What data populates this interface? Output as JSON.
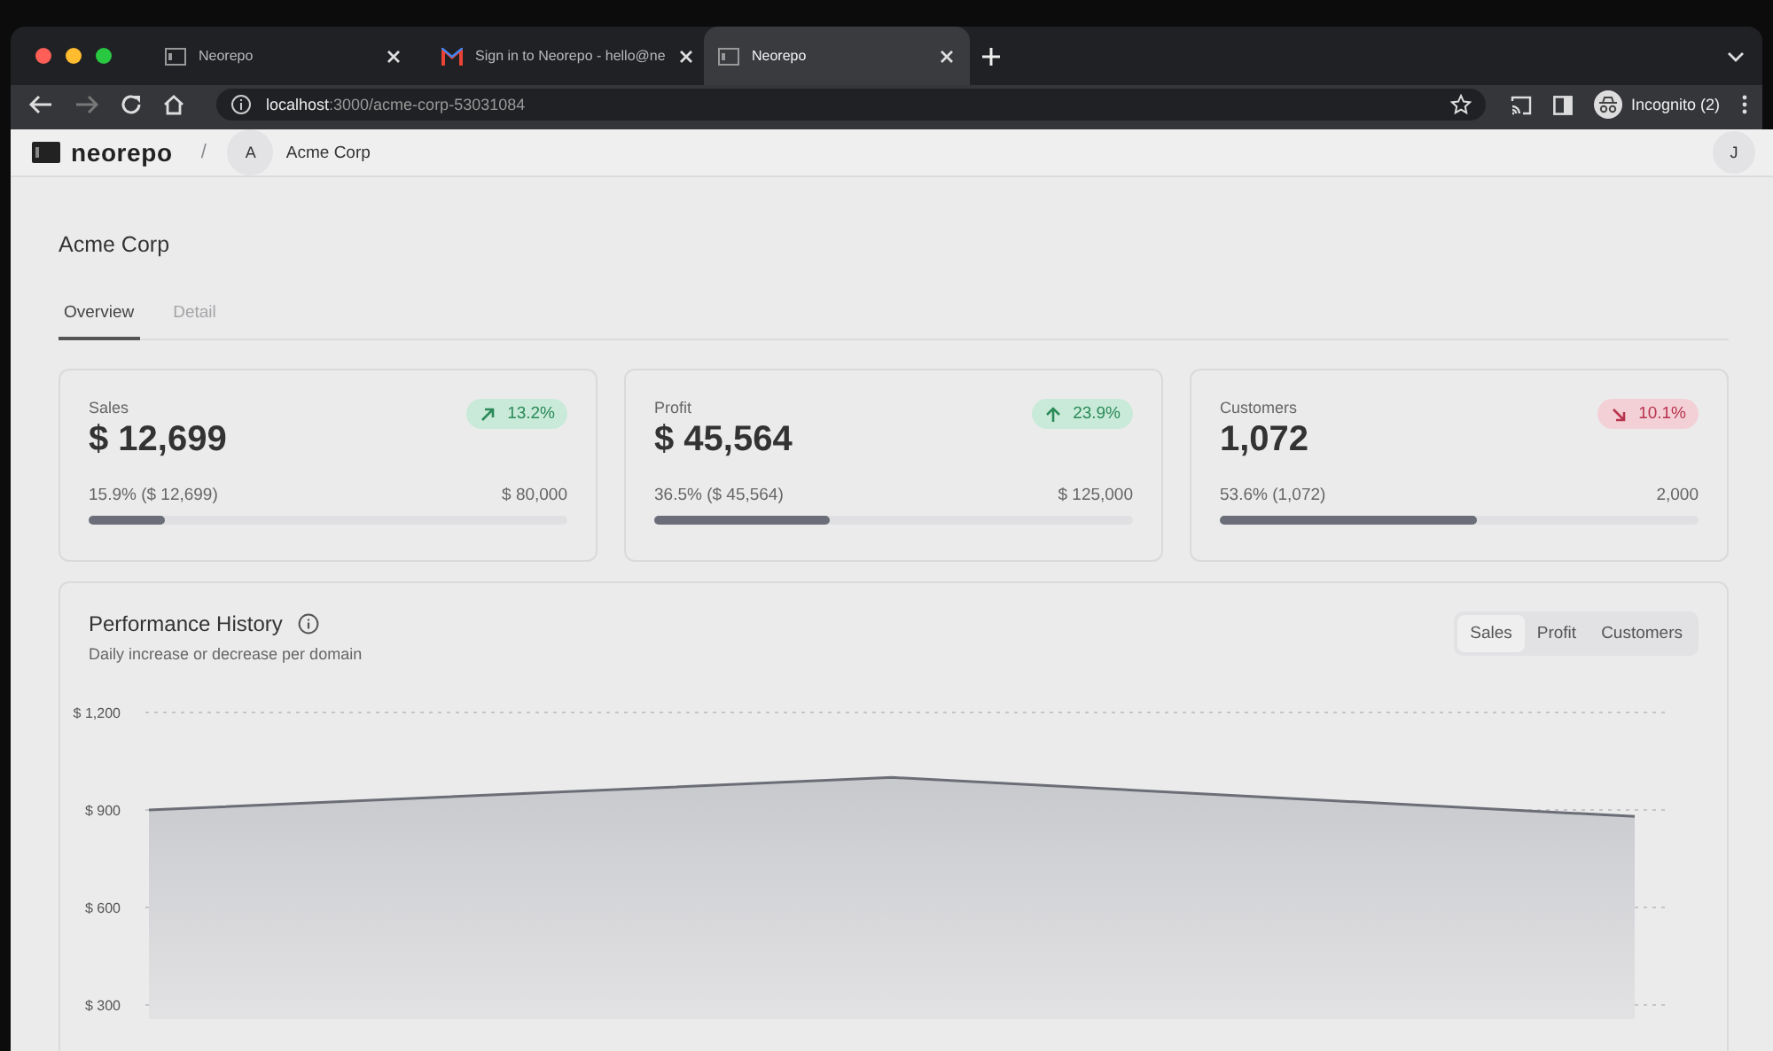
{
  "browser": {
    "tabs": [
      {
        "title": "Neorepo",
        "kind": "page",
        "selected": false
      },
      {
        "title": "Sign in to Neorepo - hello@ne",
        "kind": "mail",
        "selected": false
      },
      {
        "title": "Neorepo",
        "kind": "page",
        "selected": true
      }
    ],
    "url_host": "localhost",
    "url_path": ":3000/acme-corp-53031084",
    "profile": "Incognito (2)"
  },
  "header": {
    "logo": "neorepo",
    "separator": "/",
    "org_initial": "A",
    "org_name": "Acme Corp",
    "user_initial": "J"
  },
  "page": {
    "title": "Acme Corp",
    "tabs": [
      {
        "label": "Overview",
        "selected": true
      },
      {
        "label": "Detail",
        "selected": false
      }
    ]
  },
  "kpis": [
    {
      "label": "Sales",
      "value": "$ 12,699",
      "delta": "13.2%",
      "kind": "rising",
      "progress_text": "15.9% ($ 12,699)",
      "target": "$ 80,000",
      "level": 0.159
    },
    {
      "label": "Profit",
      "value": "$ 45,564",
      "delta": "23.9%",
      "kind": "up",
      "progress_text": "36.5% ($ 45,564)",
      "target": "$ 125,000",
      "level": 0.365
    },
    {
      "label": "Customers",
      "value": "1,072",
      "delta": "10.1%",
      "kind": "falling",
      "progress_text": "53.6% (1,072)",
      "target": "2,000",
      "level": 0.536
    }
  ],
  "performance": {
    "title": "Performance History",
    "subtitle": "Daily increase or decrease per domain",
    "segments": [
      {
        "label": "Sales",
        "selected": true
      },
      {
        "label": "Profit",
        "selected": false
      },
      {
        "label": "Customers",
        "selected": false
      }
    ],
    "chart_data": {
      "type": "area",
      "series": [
        {
          "color": "#6b6e76",
          "values": [
            900,
            1000,
            880
          ]
        }
      ],
      "ylim": [
        300,
        1200
      ],
      "yticks": [
        {
          "value": 1200,
          "label": "$ 1,200"
        },
        {
          "value": 900,
          "label": "$ 900"
        },
        {
          "value": 600,
          "label": "$ 600"
        },
        {
          "value": 300,
          "label": "$ 300"
        }
      ]
    }
  }
}
